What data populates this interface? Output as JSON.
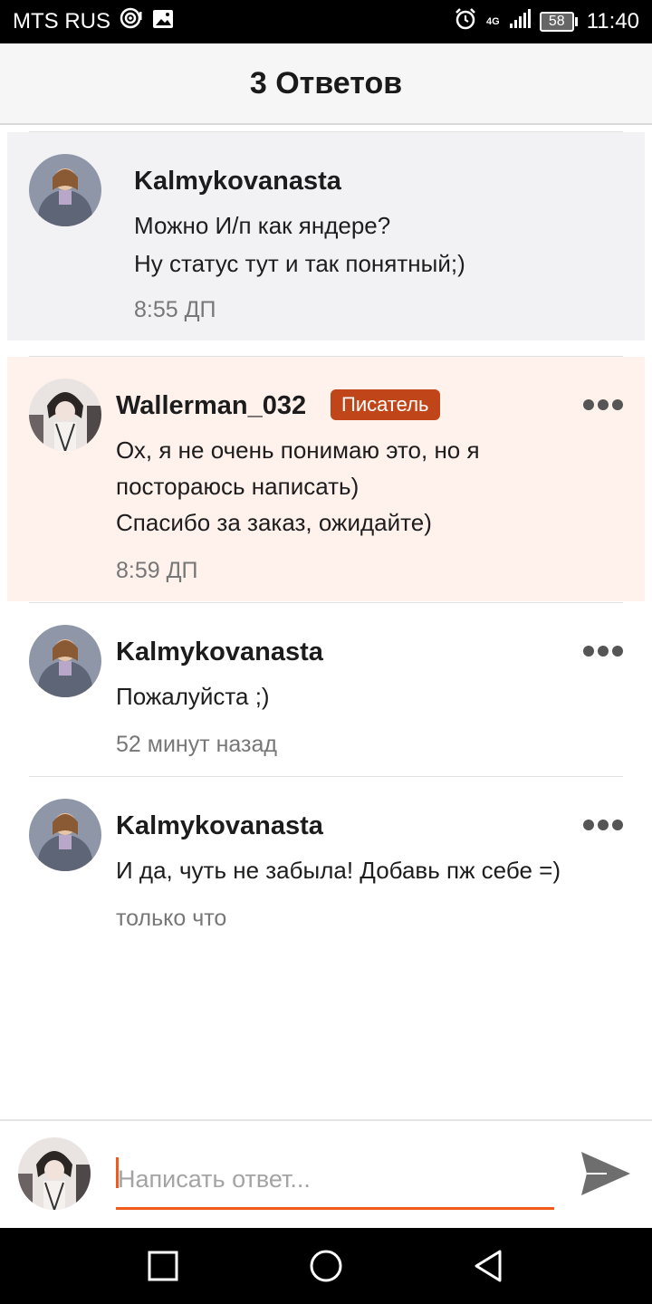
{
  "status_bar": {
    "carrier": "MTS RUS",
    "network": "4G",
    "battery": "58",
    "time": "11:40"
  },
  "header": {
    "title": "3 Ответов"
  },
  "comments": [
    {
      "author": "Kalmykovanasta",
      "lines": [
        "Можно И/п как яндере?",
        "Ну  статус тут и так понятный;)"
      ],
      "time": "8:55 ДП"
    },
    {
      "author": "Wallerman_032",
      "badge": "Писатель",
      "lines": [
        "Ох, я не очень понимаю это, но я",
        "постораюсь написать)",
        "Спасибо за заказ, ожидайте)"
      ],
      "time": "8:59 ДП"
    },
    {
      "author": "Kalmykovanasta",
      "lines": [
        "Пожалуйста ;)"
      ],
      "time": "52 минут назад"
    },
    {
      "author": "Kalmykovanasta",
      "lines": [
        "И да, чуть не забыла! Добавь пж себе =)"
      ],
      "time": "только что"
    }
  ],
  "reply": {
    "placeholder": "Написать ответ..."
  },
  "icons": {
    "more": "more-dots-icon",
    "send": "send-icon",
    "nav_recent": "square-icon",
    "nav_home": "circle-icon",
    "nav_back": "triangle-back-icon"
  },
  "colors": {
    "accent": "#ee5b1a",
    "badge": "#c0461a",
    "highlight_peach": "#fff1ec",
    "highlight_grey": "#f2f2f4"
  }
}
